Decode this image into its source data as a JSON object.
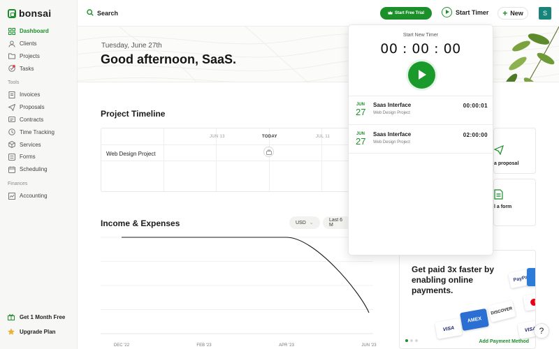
{
  "app": {
    "name": "bonsai"
  },
  "sidebar": {
    "items": [
      {
        "label": "Dashboard",
        "icon": "grid-icon",
        "active": true
      },
      {
        "label": "Clients",
        "icon": "user-icon"
      },
      {
        "label": "Projects",
        "icon": "folder-icon"
      },
      {
        "label": "Tasks",
        "icon": "check-circle-icon",
        "badge_dot": true
      }
    ],
    "tools_header": "Tools",
    "tools": [
      {
        "label": "Invoices",
        "icon": "invoice-icon"
      },
      {
        "label": "Proposals",
        "icon": "send-icon"
      },
      {
        "label": "Contracts",
        "icon": "contract-icon"
      },
      {
        "label": "Time Tracking",
        "icon": "clock-icon"
      },
      {
        "label": "Services",
        "icon": "box-icon"
      },
      {
        "label": "Forms",
        "icon": "form-icon"
      },
      {
        "label": "Scheduling",
        "icon": "calendar-icon"
      }
    ],
    "finances_header": "Finances",
    "finances": [
      {
        "label": "Accounting",
        "icon": "chart-icon"
      }
    ],
    "bottom": {
      "free_month": "Get 1 Month Free",
      "upgrade": "Upgrade Plan"
    }
  },
  "topbar": {
    "search_label": "Search",
    "trial_label": "Start Free Trial",
    "start_timer_label": "Start Timer",
    "new_label": "New",
    "avatar_initial": "S"
  },
  "hero": {
    "date": "Tuesday, June 27th",
    "greeting": "Good afternoon, SaaS."
  },
  "timeline": {
    "title": "Project Timeline",
    "columns": [
      "JUN 13",
      "TODAY",
      "JUL 11"
    ],
    "rows": [
      "Web Design Project"
    ]
  },
  "income": {
    "title": "Income & Expenses",
    "currency": "USD",
    "range": "Last 6 M",
    "chart_data": {
      "type": "line",
      "x": [
        "DEC '22",
        "FEB '23",
        "APR '23",
        "JUN '23"
      ],
      "series": [
        {
          "values": [
            1,
            1,
            1,
            0
          ]
        }
      ],
      "grid": true
    }
  },
  "quick_actions": {
    "proposal_label": "a proposal",
    "form_label": "l a form"
  },
  "payments": {
    "title": "Get paid 3x faster by enabling online payments.",
    "cta": "Add Payment Method",
    "cards": [
      "VISA",
      "AMEX",
      "DISCOVER",
      "VISA",
      "PayPal"
    ]
  },
  "timer": {
    "title": "Start New Timer",
    "clock": "00 : 00 : 00",
    "entries": [
      {
        "month": "JUN",
        "day": "27",
        "title": "Saas Interface",
        "project": "Web Design Project",
        "time": "00:00:01"
      },
      {
        "month": "JUN",
        "day": "27",
        "title": "Saas Interface",
        "project": "Web Design Project",
        "time": "02:00:00"
      }
    ]
  },
  "help_label": "?",
  "colors": {
    "brand": "#1b8f2a",
    "avatar": "#17857a"
  }
}
